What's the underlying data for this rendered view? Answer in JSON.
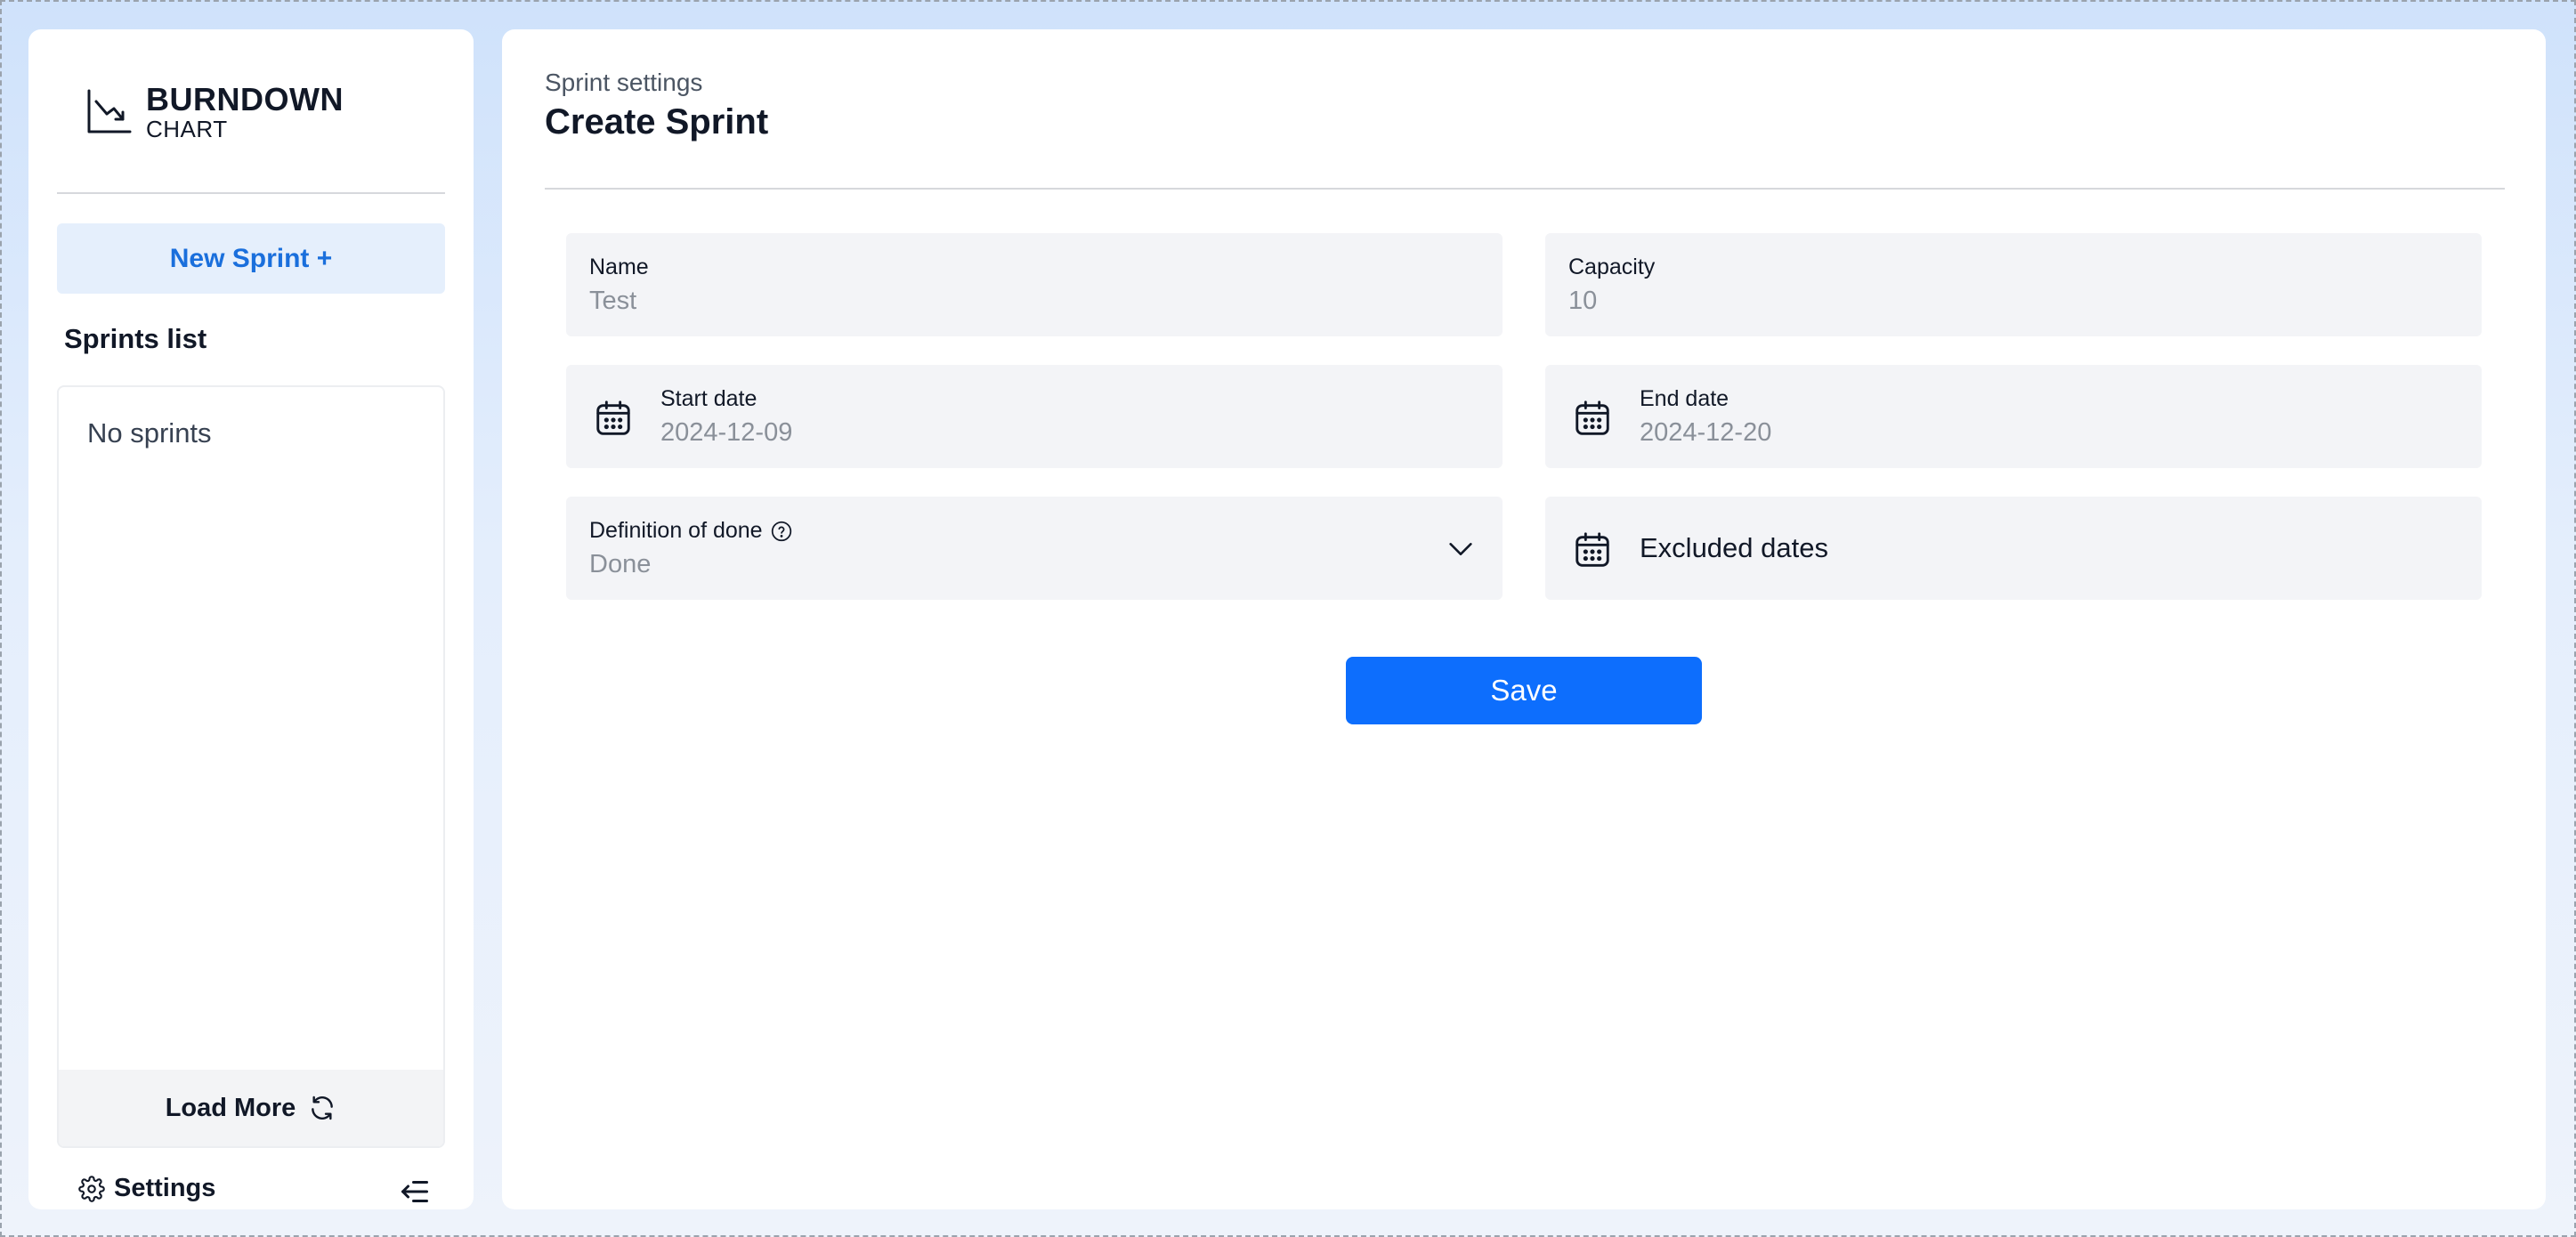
{
  "app": {
    "logo_title": "BURNDOWN",
    "logo_subtitle": "CHART"
  },
  "sidebar": {
    "new_sprint_label": "New Sprint +",
    "sprints_title": "Sprints list",
    "empty_text": "No sprints",
    "load_more_label": "Load More",
    "settings_label": "Settings"
  },
  "main": {
    "breadcrumb": "Sprint settings",
    "title": "Create Sprint",
    "form": {
      "name": {
        "label": "Name",
        "value": "Test"
      },
      "capacity": {
        "label": "Capacity",
        "value": "10"
      },
      "start_date": {
        "label": "Start date",
        "value": "2024-12-09"
      },
      "end_date": {
        "label": "End date",
        "value": "2024-12-20"
      },
      "definition_of_done": {
        "label": "Definition of done",
        "value": "Done"
      },
      "excluded_dates": {
        "label": "Excluded dates"
      }
    },
    "save_label": "Save"
  },
  "colors": {
    "accent": "#0d6efd",
    "new_sprint_bg": "#e5effc",
    "new_sprint_text": "#1a6fdc",
    "field_bg": "#f3f4f7"
  },
  "icons": {
    "logo": "chart-down-icon",
    "date": "calendar-icon",
    "help": "question-circle-icon",
    "dropdown": "chevron-down-icon",
    "refresh": "refresh-icon",
    "settings": "gear-icon",
    "collapse": "collapse-sidebar-icon"
  }
}
